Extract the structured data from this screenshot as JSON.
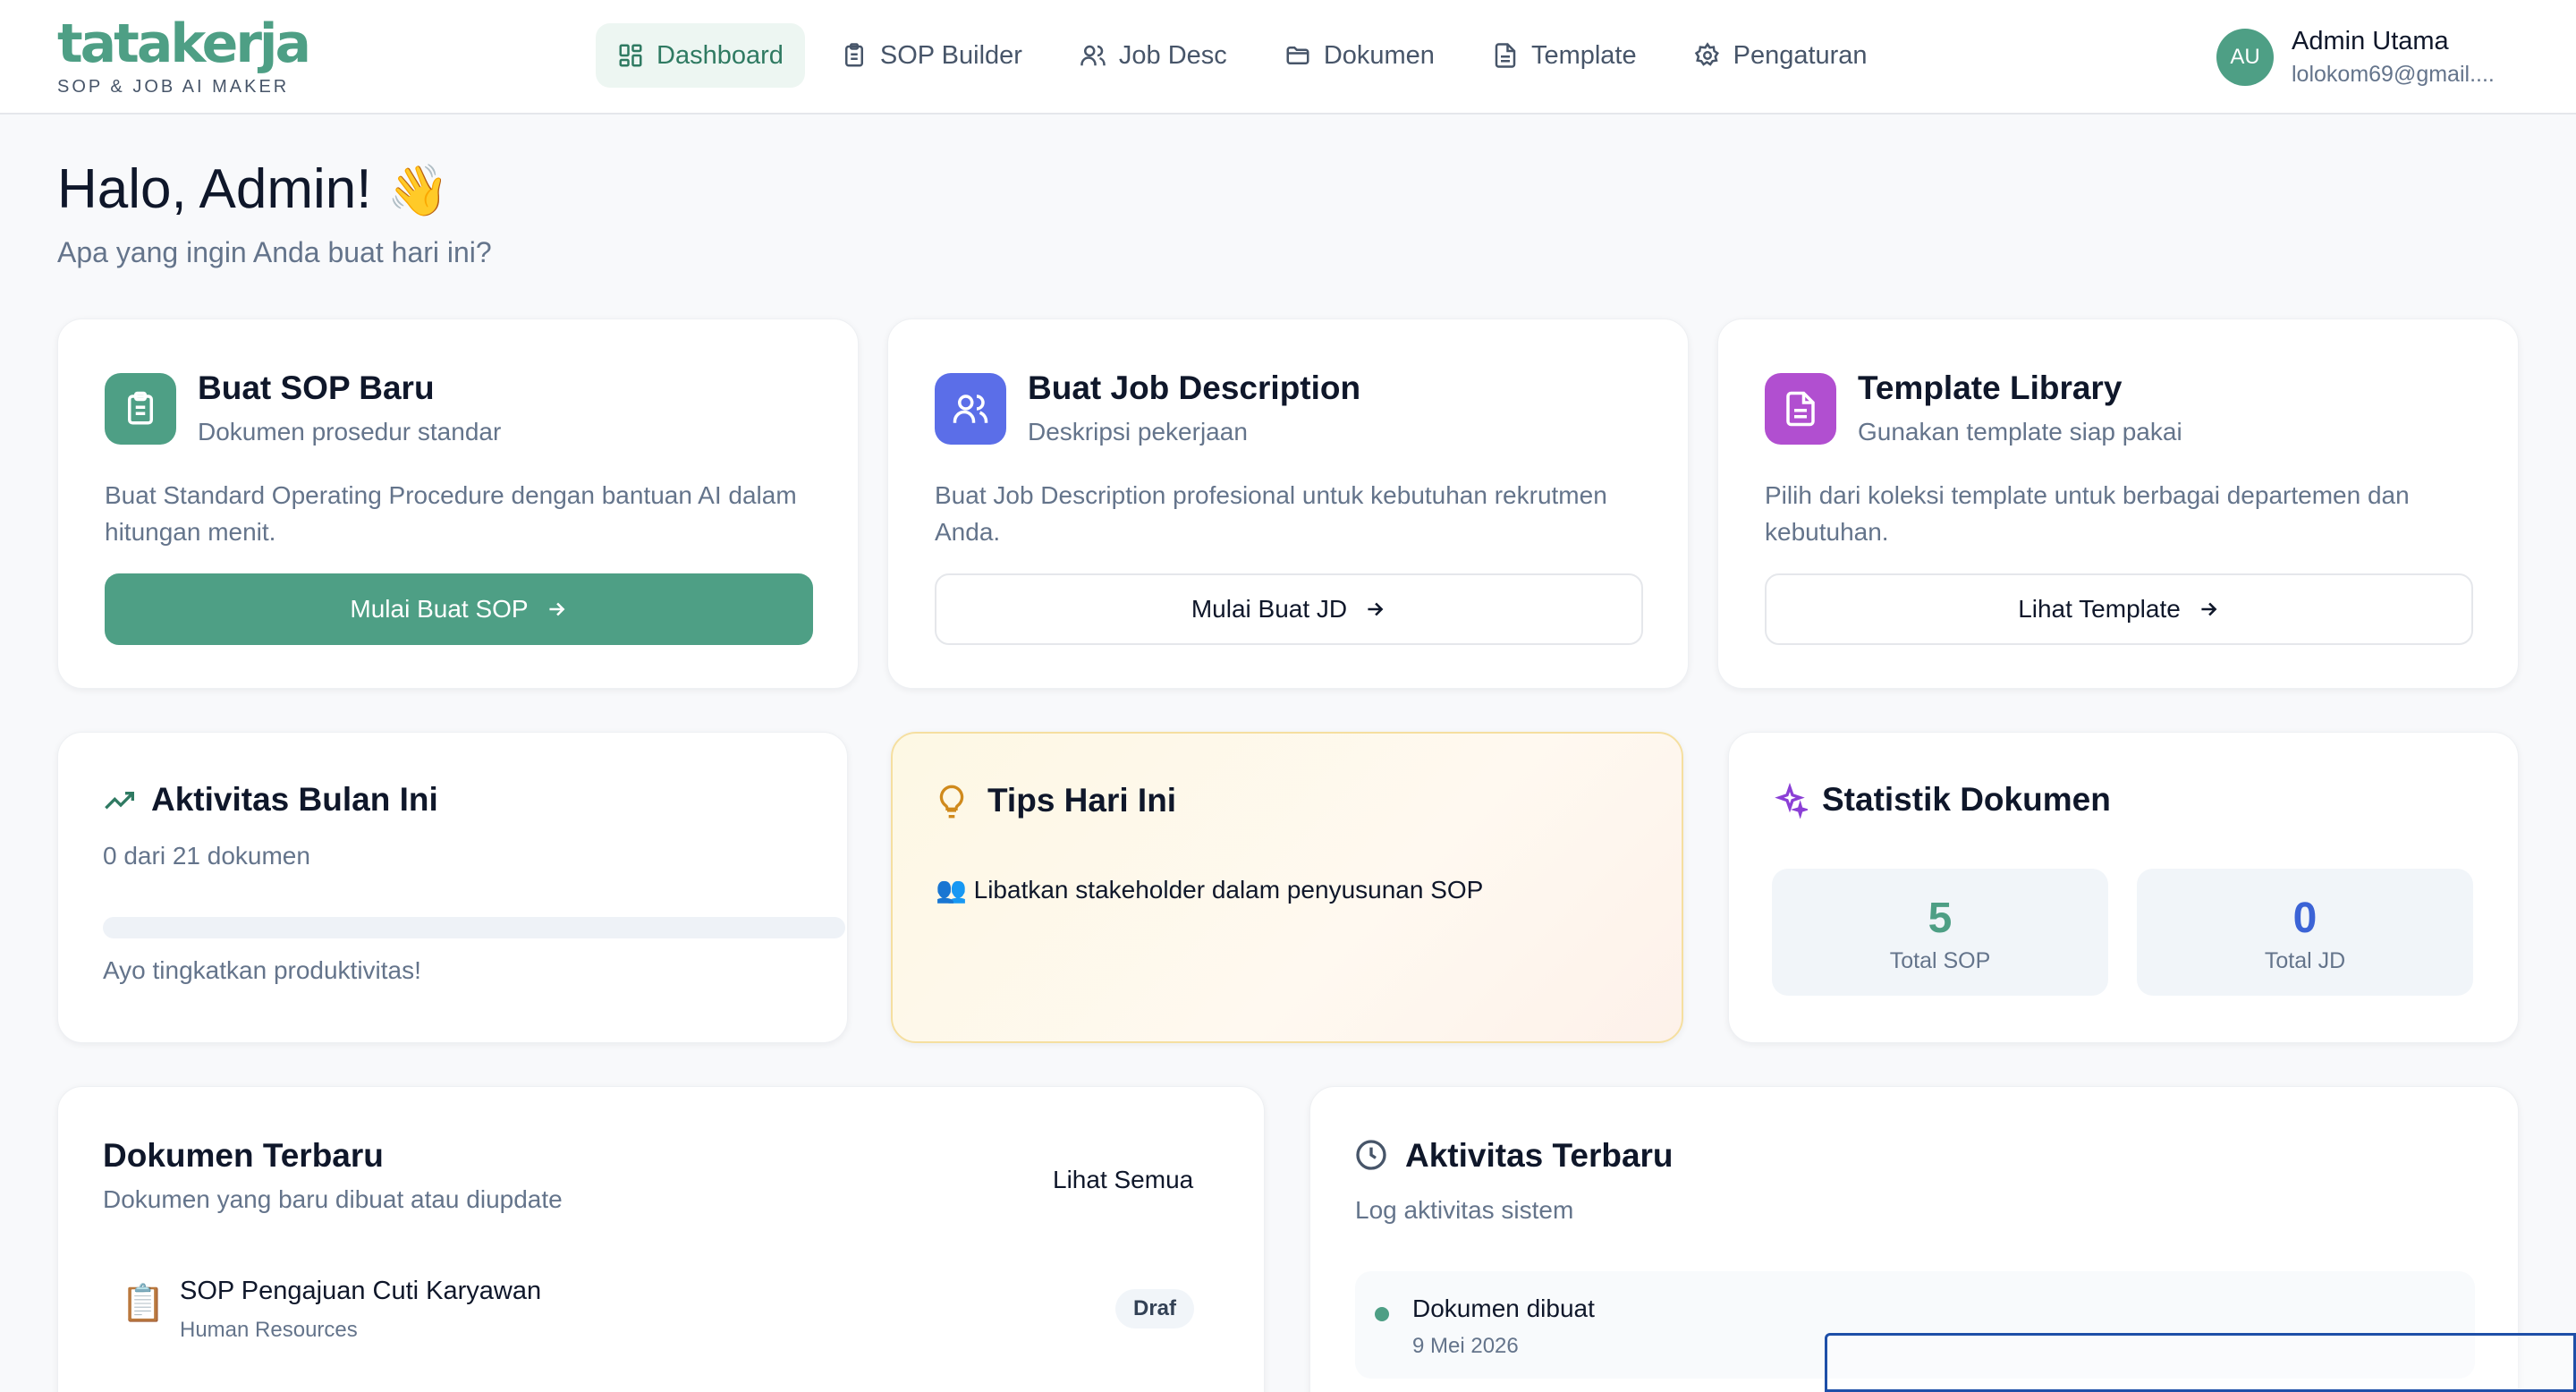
{
  "brand": {
    "name": "tatakerja",
    "tagline": "SOP & JOB AI MAKER",
    "color": "#4e9f85"
  },
  "nav": [
    {
      "label": "Dashboard",
      "icon": "layout-grid-icon",
      "active": true
    },
    {
      "label": "SOP Builder",
      "icon": "clipboard-icon"
    },
    {
      "label": "Job Desc",
      "icon": "users-icon"
    },
    {
      "label": "Dokumen",
      "icon": "folder-icon"
    },
    {
      "label": "Template",
      "icon": "file-text-icon"
    },
    {
      "label": "Pengaturan",
      "icon": "gear-icon"
    }
  ],
  "user": {
    "initials": "AU",
    "name": "Admin Utama",
    "email": "lolokom69@gmail...."
  },
  "greeting": {
    "title": "Halo, Admin!",
    "emoji": "👋",
    "subtitle": "Apa yang ingin Anda buat hari ini?"
  },
  "quick_actions": [
    {
      "title": "Buat SOP Baru",
      "subtitle": "Dokumen prosedur standar",
      "description": "Buat Standard Operating Procedure dengan bantuan AI dalam hitungan menit.",
      "button": "Mulai Buat SOP",
      "icon": "clipboard-icon",
      "color": "#4e9f85"
    },
    {
      "title": "Buat Job Description",
      "subtitle": "Deskripsi pekerjaan",
      "description": "Buat Job Description profesional untuk kebutuhan rekrutmen Anda.",
      "button": "Mulai Buat JD",
      "icon": "users-icon",
      "color": "#5b6ee8"
    },
    {
      "title": "Template Library",
      "subtitle": "Gunakan template siap pakai",
      "description": "Pilih dari koleksi template untuk berbagai departemen dan kebutuhan.",
      "button": "Lihat Template",
      "icon": "file-text-icon",
      "color": "#b14fd0"
    }
  ],
  "activity": {
    "title": "Aktivitas Bulan Ini",
    "count_text": "0 dari 21 dokumen",
    "progress": 0,
    "motivation": "Ayo tingkatkan produktivitas!",
    "icon": "trending-up-icon"
  },
  "tips": {
    "title": "Tips Hari Ini",
    "tip": "👥 Libatkan stakeholder dalam penyusunan SOP",
    "icon": "lightbulb-icon"
  },
  "stats": {
    "title": "Statistik Dokumen",
    "icon": "sparkles-icon",
    "items": [
      {
        "value": "5",
        "label": "Total SOP",
        "color": "#4e9f85"
      },
      {
        "value": "0",
        "label": "Total JD",
        "color": "#3b63d6"
      }
    ]
  },
  "recent_docs": {
    "title": "Dokumen Terbaru",
    "subtitle": "Dokumen yang baru dibuat atau diupdate",
    "link": "Lihat Semua",
    "items": [
      {
        "icon": "📋",
        "title": "SOP Pengajuan Cuti Karyawan",
        "department": "Human Resources",
        "status": "Draf"
      }
    ]
  },
  "recent_activity": {
    "title": "Aktivitas Terbaru",
    "subtitle": "Log aktivitas sistem",
    "icon": "clock-icon",
    "items": [
      {
        "title": "Dokumen dibuat",
        "date": "9 Mei 2026"
      }
    ]
  }
}
